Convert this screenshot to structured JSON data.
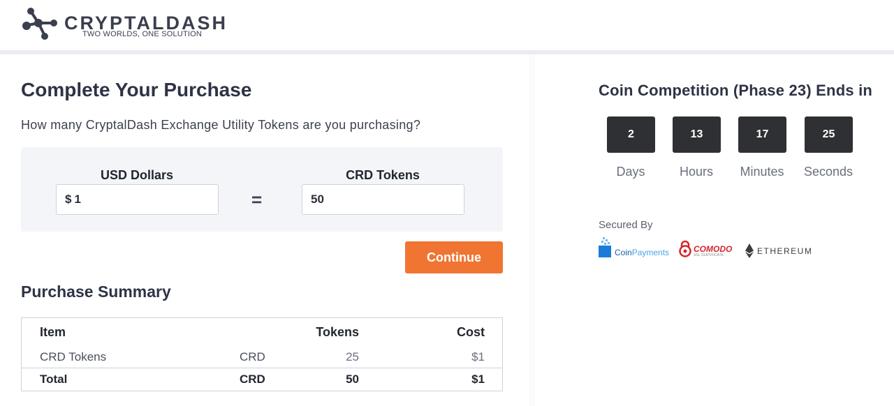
{
  "brand": {
    "name": "CRYPTALDASH",
    "tagline": "TWO WORLDS, ONE SOLUTION"
  },
  "purchase": {
    "title": "Complete Your Purchase",
    "question": "How many CryptalDash Exchange Utility Tokens are you purchasing?",
    "usd_label": "USD Dollars",
    "usd_prefix": "$",
    "usd_value": "1",
    "equals": "=",
    "crd_label": "CRD Tokens",
    "crd_value": "50",
    "continue_label": "Continue"
  },
  "summary": {
    "title": "Purchase Summary",
    "headers": {
      "item": "Item",
      "tokens": "Tokens",
      "cost": "Cost"
    },
    "rows": [
      {
        "item": "CRD Tokens",
        "unit": "CRD",
        "tokens": "25",
        "cost": "$1"
      }
    ],
    "total": {
      "item": "Total",
      "unit": "CRD",
      "tokens": "50",
      "cost": "$1"
    }
  },
  "competition": {
    "title": "Coin Competition (Phase 23) Ends in",
    "timer": [
      {
        "value": "2",
        "label": "Days"
      },
      {
        "value": "13",
        "label": "Hours"
      },
      {
        "value": "17",
        "label": "Minutes"
      },
      {
        "value": "25",
        "label": "Seconds"
      }
    ]
  },
  "security": {
    "label": "Secured By",
    "badges": {
      "coinpayments_a": "Coin",
      "coinpayments_b": "Payments",
      "comodo": "COMODO",
      "comodo_sub": "SSL CERTIFICATE",
      "ethereum": "ETHEREUM"
    }
  },
  "colors": {
    "accent": "#f07533",
    "timer_bg": "#2f3033",
    "panel_bg": "#f4f5f9",
    "text_dark": "#2e3345",
    "coinpayments_blue": "#1c7bd8",
    "comodo_red": "#d4262c"
  },
  "icons": {
    "logo": "molecule-dots-logo-icon",
    "coinpayments": "coinpayments-logo-icon",
    "comodo": "comodo-lock-icon",
    "ethereum": "ethereum-diamond-icon"
  }
}
